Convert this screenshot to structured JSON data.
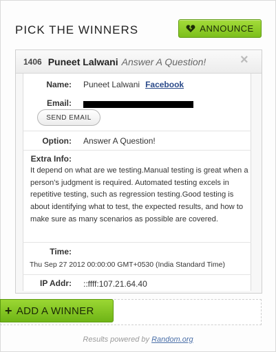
{
  "header": {
    "title": "PICK THE WINNERS",
    "announce_label": "ANNOUNCE",
    "announce_icon": "broken-heart-icon"
  },
  "entry": {
    "number": "1406",
    "name": "Puneet Lalwani",
    "option_header": "Answer A Question!",
    "close_icon": "close-icon",
    "fields": {
      "name_label": "Name:",
      "name_value": "Puneet Lalwani",
      "facebook_link": "Facebook",
      "email_label": "Email:",
      "send_email_label": "SEND EMAIL",
      "option_label": "Option:",
      "option_value": "Answer A Question!",
      "extra_label": "Extra Info:",
      "extra_value": "It depend on what are we testing.Manual testing is great when a person's judgment is required. Automated testing excels in repetitive testing, such as regression testing.Good testing is about identifying what to test, the expected results, and how to make sure as many scenarios as possible are covered.",
      "time_label": "Time:",
      "time_value": "Thu Sep 27 2012 00:00:00 GMT+0530 (India Standard Time)",
      "ip_label": "IP Addr:",
      "ip_value": "::ffff:107.21.64.40"
    }
  },
  "add_winner": {
    "label": "ADD A WINNER",
    "icon": "plus-icon"
  },
  "footer": {
    "prefix": "Results powered by",
    "link": "Random.org"
  },
  "colors": {
    "accent_green": "#8cc926",
    "link_blue": "#2a4a8a"
  }
}
